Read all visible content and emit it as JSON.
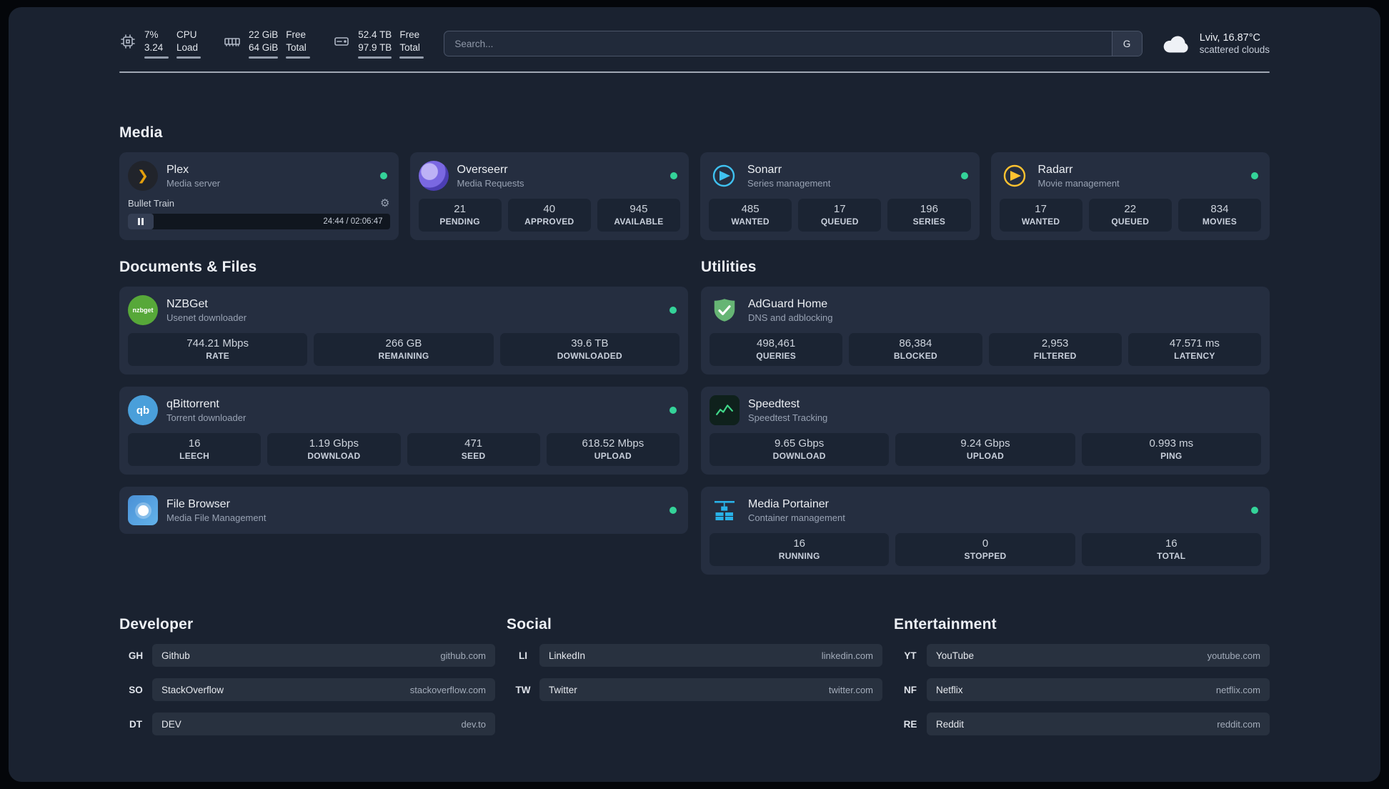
{
  "topbar": {
    "cpu": {
      "value_line1": "7%",
      "value_line2": "3.24",
      "label_line1": "CPU",
      "label_line2": "Load"
    },
    "memory": {
      "value_line1": "22 GiB",
      "value_line2": "64 GiB",
      "label_line1": "Free",
      "label_line2": "Total"
    },
    "disk": {
      "value_line1": "52.4 TB",
      "value_line2": "97.9 TB",
      "label_line1": "Free",
      "label_line2": "Total"
    },
    "search": {
      "placeholder": "Search...",
      "engine_label": "G"
    },
    "weather": {
      "location": "Lviv, 16.87°C",
      "condition": "scattered clouds"
    }
  },
  "media": {
    "title": "Media",
    "plex": {
      "name": "Plex",
      "subtitle": "Media server",
      "now_playing": "Bullet Train",
      "time": "24:44 / 02:06:47"
    },
    "overseerr": {
      "name": "Overseerr",
      "subtitle": "Media Requests",
      "stats": [
        {
          "value": "21",
          "label": "PENDING"
        },
        {
          "value": "40",
          "label": "APPROVED"
        },
        {
          "value": "945",
          "label": "AVAILABLE"
        }
      ]
    },
    "sonarr": {
      "name": "Sonarr",
      "subtitle": "Series management",
      "stats": [
        {
          "value": "485",
          "label": "WANTED"
        },
        {
          "value": "17",
          "label": "QUEUED"
        },
        {
          "value": "196",
          "label": "SERIES"
        }
      ]
    },
    "radarr": {
      "name": "Radarr",
      "subtitle": "Movie management",
      "stats": [
        {
          "value": "17",
          "label": "WANTED"
        },
        {
          "value": "22",
          "label": "QUEUED"
        },
        {
          "value": "834",
          "label": "MOVIES"
        }
      ]
    }
  },
  "documents": {
    "title": "Documents & Files",
    "nzbget": {
      "name": "NZBGet",
      "subtitle": "Usenet downloader",
      "stats": [
        {
          "value": "744.21 Mbps",
          "label": "RATE"
        },
        {
          "value": "266 GB",
          "label": "REMAINING"
        },
        {
          "value": "39.6 TB",
          "label": "DOWNLOADED"
        }
      ]
    },
    "qbittorrent": {
      "name": "qBittorrent",
      "subtitle": "Torrent downloader",
      "stats": [
        {
          "value": "16",
          "label": "LEECH"
        },
        {
          "value": "1.19 Gbps",
          "label": "DOWNLOAD"
        },
        {
          "value": "471",
          "label": "SEED"
        },
        {
          "value": "618.52 Mbps",
          "label": "UPLOAD"
        }
      ]
    },
    "filebrowser": {
      "name": "File Browser",
      "subtitle": "Media File Management"
    }
  },
  "utilities": {
    "title": "Utilities",
    "adguard": {
      "name": "AdGuard Home",
      "subtitle": "DNS and adblocking",
      "stats": [
        {
          "value": "498,461",
          "label": "QUERIES"
        },
        {
          "value": "86,384",
          "label": "BLOCKED"
        },
        {
          "value": "2,953",
          "label": "FILTERED"
        },
        {
          "value": "47.571 ms",
          "label": "LATENCY"
        }
      ]
    },
    "speedtest": {
      "name": "Speedtest",
      "subtitle": "Speedtest Tracking",
      "stats": [
        {
          "value": "9.65 Gbps",
          "label": "DOWNLOAD"
        },
        {
          "value": "9.24 Gbps",
          "label": "UPLOAD"
        },
        {
          "value": "0.993 ms",
          "label": "PING"
        }
      ]
    },
    "portainer": {
      "name": "Media Portainer",
      "subtitle": "Container management",
      "stats": [
        {
          "value": "16",
          "label": "RUNNING"
        },
        {
          "value": "0",
          "label": "STOPPED"
        },
        {
          "value": "16",
          "label": "TOTAL"
        }
      ]
    }
  },
  "bookmarks": {
    "developer": {
      "title": "Developer",
      "items": [
        {
          "abbr": "GH",
          "name": "Github",
          "url": "github.com"
        },
        {
          "abbr": "SO",
          "name": "StackOverflow",
          "url": "stackoverflow.com"
        },
        {
          "abbr": "DT",
          "name": "DEV",
          "url": "dev.to"
        }
      ]
    },
    "social": {
      "title": "Social",
      "items": [
        {
          "abbr": "LI",
          "name": "LinkedIn",
          "url": "linkedin.com"
        },
        {
          "abbr": "TW",
          "name": "Twitter",
          "url": "twitter.com"
        }
      ]
    },
    "entertainment": {
      "title": "Entertainment",
      "items": [
        {
          "abbr": "YT",
          "name": "YouTube",
          "url": "youtube.com"
        },
        {
          "abbr": "NF",
          "name": "Netflix",
          "url": "netflix.com"
        },
        {
          "abbr": "RE",
          "name": "Reddit",
          "url": "reddit.com"
        }
      ]
    }
  },
  "icons": {
    "gear": "⚙",
    "plex_chevron": "❯",
    "nzbget_label": "nzbget",
    "qbittorrent_label": "qb"
  },
  "colors": {
    "background": "#1a2230",
    "card": "#252e40",
    "status_online": "#34d399",
    "plex_accent": "#e5a00d",
    "overseerr_accent": "#6a5ae0",
    "sonarr_accent": "#3fc1f0",
    "radarr_accent": "#ffc230",
    "nzbget_accent": "#57a839",
    "qbittorrent_accent": "#4a9fda",
    "filebrowser_accent": "#4f9fdc",
    "adguard_accent": "#66b574",
    "speedtest_accent": "#41d98a",
    "portainer_accent": "#29b2e8"
  }
}
